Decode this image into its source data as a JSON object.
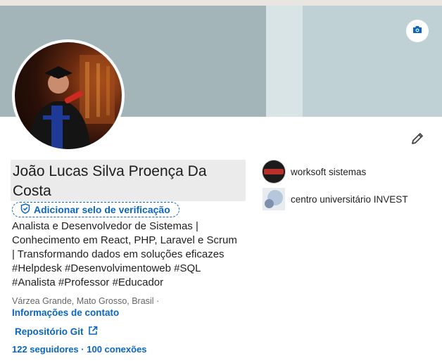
{
  "profile": {
    "name": "João Lucas Silva Proença Da Costa",
    "verify_label": "Adicionar selo de verificação",
    "headline": "Analista e Desenvolvedor de Sistemas |\nConhecimento em React, PHP, Laravel e Scrum\n| Transformando dados em soluções eficazes\n#Helpdesk #Desenvolvimentoweb #SQL\n#Analista #Professor #Educador",
    "location": "Várzea Grande, Mato Grosso, Brasil ·",
    "contact_label": "Informações de contato",
    "link_label": "Repositório Git",
    "followers": "122 seguidores",
    "separator": "·",
    "connections": "100 conexões"
  },
  "organizations": [
    {
      "name": "worksoft sistemas",
      "icon": "worksoft-logo"
    },
    {
      "name": "centro universitário INVEST",
      "icon": "invest-logo"
    }
  ],
  "icons": {
    "camera": "camera-icon",
    "edit": "pencil-icon",
    "verify": "shield-check-icon",
    "external": "external-link-icon"
  },
  "colors": {
    "accent": "#0a66c2",
    "banner_light": "#c0d1d5",
    "banner_dark": "#a3b5b9",
    "name_highlight": "#ebebeb"
  }
}
